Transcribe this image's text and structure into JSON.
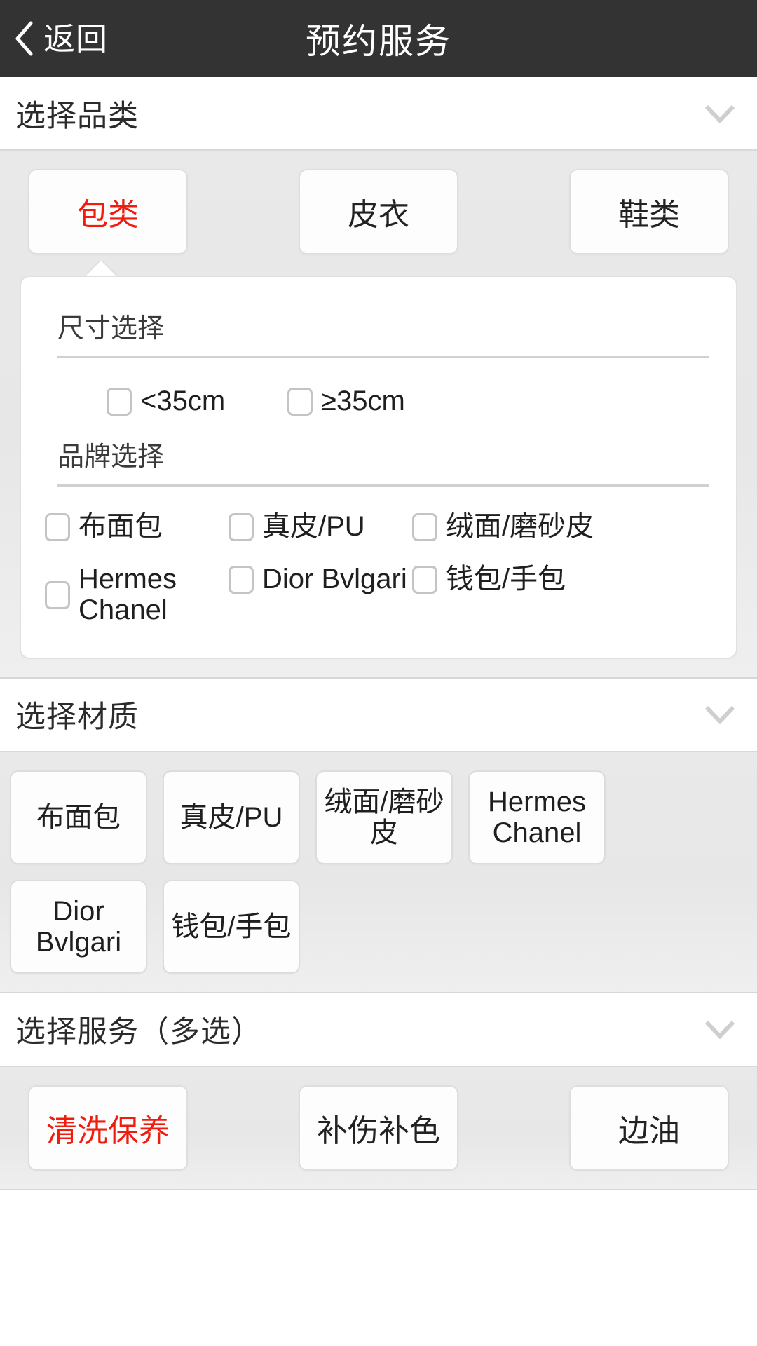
{
  "header": {
    "back_label": "返回",
    "back_icon": "chevron-left-icon",
    "title": "预约服务",
    "background_color": "#333333",
    "text_color": "#ffffff"
  },
  "theme": {
    "accent_color": "#f01c0e",
    "page_background": "#e8e8e8",
    "card_background": "#ffffff",
    "border_color": "#dedede"
  },
  "sections": {
    "category": {
      "title": "选择品类",
      "collapse_icon": "chevron-down-icon",
      "tabs": [
        {
          "label": "包类",
          "selected": true
        },
        {
          "label": "皮衣",
          "selected": false
        },
        {
          "label": "鞋类",
          "selected": false
        }
      ],
      "detail": {
        "size_group": {
          "label": "尺寸选择",
          "options": [
            {
              "label": "<35cm",
              "checked": false
            },
            {
              "label": "≥35cm",
              "checked": false
            }
          ]
        },
        "brand_group": {
          "label": "品牌选择",
          "options": [
            {
              "label": "布面包",
              "checked": false
            },
            {
              "label": "真皮/PU",
              "checked": false
            },
            {
              "label": "绒面/磨砂皮",
              "checked": false
            },
            {
              "label": "Hermes\nChanel",
              "checked": false
            },
            {
              "label": "Dior Bvlgari",
              "checked": false
            },
            {
              "label": "钱包/手包",
              "checked": false
            }
          ]
        }
      }
    },
    "material": {
      "title": "选择材质",
      "collapse_icon": "chevron-down-icon",
      "chips": [
        {
          "label": "布面包",
          "selected": false
        },
        {
          "label": "真皮/PU",
          "selected": false
        },
        {
          "label": "绒面/磨砂\n皮",
          "selected": false
        },
        {
          "label": "Hermes\nChanel",
          "selected": false
        },
        {
          "label": "Dior\nBvlgari",
          "selected": false
        },
        {
          "label": "钱包/手包",
          "selected": false
        }
      ]
    },
    "service": {
      "title": "选择服务（多选）",
      "collapse_icon": "chevron-down-icon",
      "buttons": [
        {
          "label": "清洗保养",
          "selected": true
        },
        {
          "label": "补伤补色",
          "selected": false
        },
        {
          "label": "边油",
          "selected": false
        }
      ]
    }
  }
}
